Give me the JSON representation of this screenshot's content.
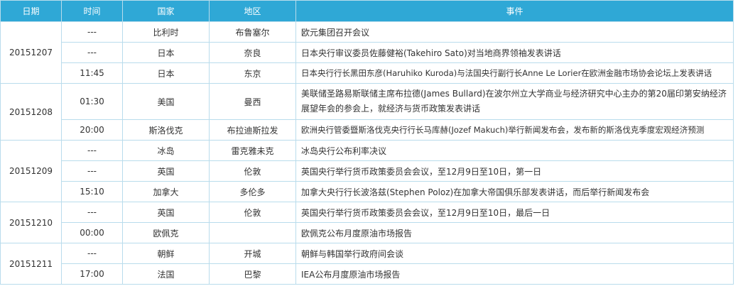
{
  "headers": [
    "日期",
    "时间",
    "国家",
    "地区",
    "事件"
  ],
  "groups": [
    {
      "date": "20151207",
      "rows": [
        {
          "time": "---",
          "country": "比利时",
          "region": "布鲁塞尔",
          "event": "欧元集团召开会议"
        },
        {
          "time": "---",
          "country": "日本",
          "region": "奈良",
          "event": "日本央行审议委员佐藤健裕(Takehiro Sato)对当地商界领袖发表讲话"
        },
        {
          "time": "11:45",
          "country": "日本",
          "region": "东京",
          "event": "日本央行行长黑田东彦(Haruhiko Kuroda)与法国央行副行长Anne Le Lorier在欧洲金融市场协会论坛上发表讲话"
        }
      ]
    },
    {
      "date": "20151208",
      "rows": [
        {
          "time": "01:30",
          "country": "美国",
          "region": "曼西",
          "event": "美联储圣路易斯联储主席布拉德(James Bullard)在波尔州立大学商业与经济研究中心主办的第20届印第安纳经济展望年会的参会上，就经济与货币政策发表讲话"
        },
        {
          "time": "20:00",
          "country": "斯洛伐克",
          "region": "布拉迪斯拉发",
          "event": "欧洲央行管委暨斯洛伐克央行行长马库赫(Jozef Makuch)举行新闻发布会，发布新的斯洛伐克季度宏观经济预测"
        }
      ]
    },
    {
      "date": "20151209",
      "rows": [
        {
          "time": "---",
          "country": "冰岛",
          "region": "雷克雅未克",
          "event": "冰岛央行公布利率决议"
        },
        {
          "time": "---",
          "country": "英国",
          "region": "伦敦",
          "event": "英国央行举行货币政策委员会会议，至12月9日至10日，第一日"
        },
        {
          "time": "15:10",
          "country": "加拿大",
          "region": "多伦多",
          "event": "加拿大央行行长波洛兹(Stephen Poloz)在加拿大帝国俱乐部发表讲话，而后举行新闻发布会"
        }
      ]
    },
    {
      "date": "20151210",
      "rows": [
        {
          "time": "---",
          "country": "英国",
          "region": "伦敦",
          "event": "英国央行举行货币政策委员会会议，至12月9日至10日，最后一日"
        },
        {
          "time": "00:00",
          "country": "欧佩克",
          "region": "",
          "event": "欧佩克公布月度原油市场报告"
        }
      ]
    },
    {
      "date": "20151211",
      "rows": [
        {
          "time": "---",
          "country": "朝鲜",
          "region": "开城",
          "event": "朝鲜与韩国举行政府间会谈"
        },
        {
          "time": "17:00",
          "country": "法国",
          "region": "巴黎",
          "event": "IEA公布月度原油市场报告"
        }
      ]
    }
  ]
}
